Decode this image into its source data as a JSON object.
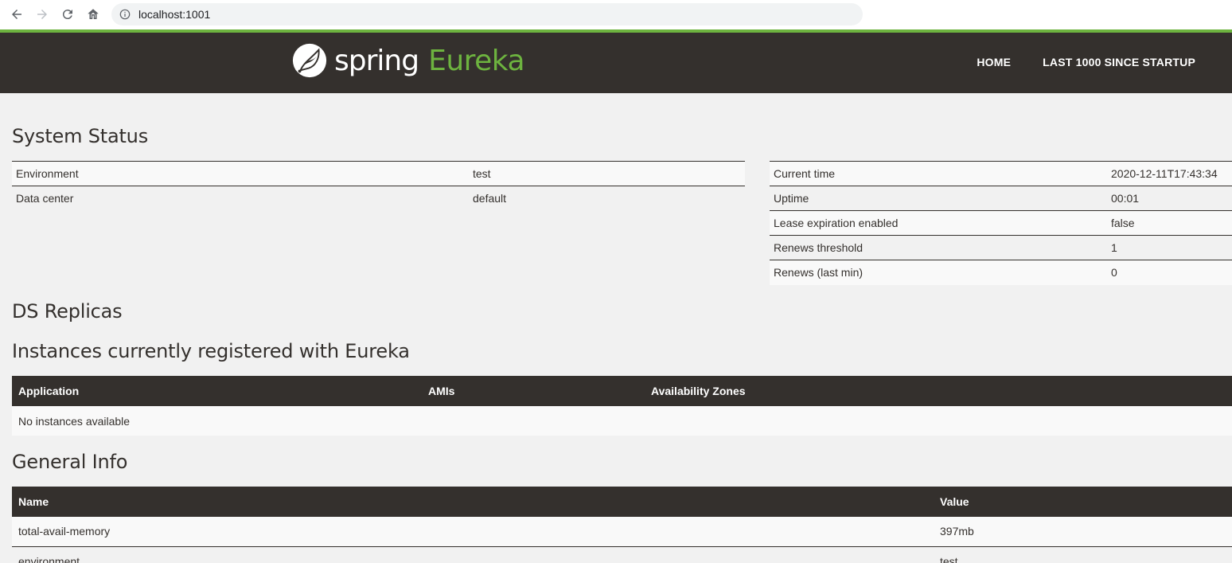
{
  "browser": {
    "url": "localhost:1001"
  },
  "header": {
    "brand_spring": "spring",
    "brand_eureka": "Eureka",
    "nav": [
      "HOME",
      "LAST 1000 SINCE STARTUP"
    ]
  },
  "system_status": {
    "title": "System Status",
    "left": [
      {
        "label": "Environment",
        "value": "test"
      },
      {
        "label": "Data center",
        "value": "default"
      }
    ],
    "right": [
      {
        "label": "Current time",
        "value": "2020-12-11T17:43:34"
      },
      {
        "label": "Uptime",
        "value": "00:01"
      },
      {
        "label": "Lease expiration enabled",
        "value": "false"
      },
      {
        "label": "Renews threshold",
        "value": "1"
      },
      {
        "label": "Renews (last min)",
        "value": "0"
      }
    ]
  },
  "ds_replicas": {
    "title": "DS Replicas"
  },
  "instances": {
    "title": "Instances currently registered with Eureka",
    "columns": [
      "Application",
      "AMIs",
      "Availability Zones"
    ],
    "empty_message": "No instances available"
  },
  "general_info": {
    "title": "General Info",
    "columns": [
      "Name",
      "Value"
    ],
    "rows": [
      {
        "name": "total-avail-memory",
        "value": "397mb"
      },
      {
        "name": "environment",
        "value": "test"
      }
    ]
  },
  "colors": {
    "brand_green": "#6db33f",
    "navbar_dark": "#34302d",
    "page_bg": "#f1f1f1"
  }
}
